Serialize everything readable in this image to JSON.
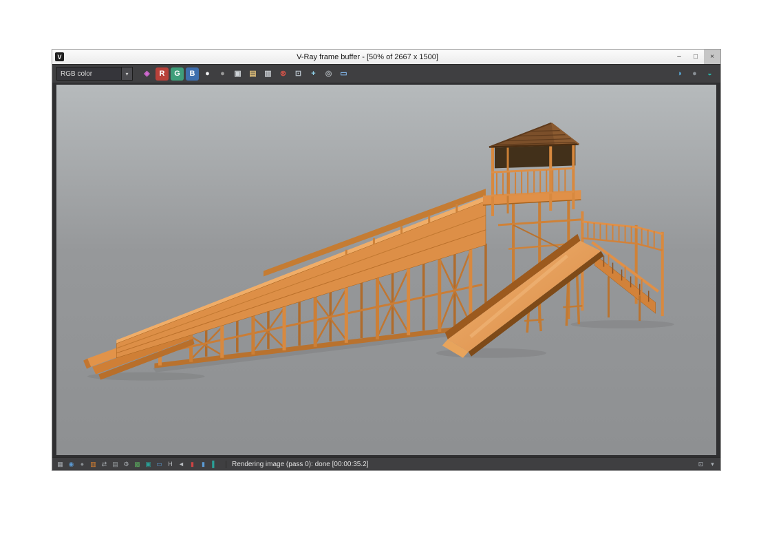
{
  "window": {
    "title": "V-Ray frame buffer - [50% of 2667 x 1500]",
    "app_icon_glyph": "V",
    "controls": [
      {
        "name": "minimize-button",
        "glyph": "–"
      },
      {
        "name": "maximize-button",
        "glyph": "□"
      },
      {
        "name": "close-button",
        "glyph": "×",
        "bg": "#c6c6c6"
      }
    ]
  },
  "toolbar": {
    "channel_dropdown": {
      "value": "RGB color",
      "arrow": "▾"
    },
    "left_buttons": [
      {
        "name": "vfb-channels-icon",
        "glyph": "◈",
        "color": "#d46ad4"
      },
      {
        "name": "red-channel-button",
        "glyph": "R",
        "color": "#ffffff",
        "bg": "#b8413a"
      },
      {
        "name": "green-channel-button",
        "glyph": "G",
        "color": "#ffffff",
        "bg": "#3f9e7a"
      },
      {
        "name": "blue-channel-button",
        "glyph": "B",
        "color": "#ffffff",
        "bg": "#3f6fae"
      },
      {
        "name": "alpha-channel-button",
        "glyph": "●",
        "color": "#f2f2f2"
      },
      {
        "name": "monochrome-button",
        "glyph": "●",
        "color": "#9a9a9a"
      },
      {
        "name": "save-image-button",
        "glyph": "▣",
        "color": "#cfd4d8"
      },
      {
        "name": "open-image-button",
        "glyph": "▤",
        "color": "#d8b977"
      },
      {
        "name": "clear-image-button",
        "glyph": "▥",
        "color": "#c7cbd0"
      },
      {
        "name": "stop-render-button",
        "glyph": "⊗",
        "color": "#d05248"
      },
      {
        "name": "duplicate-buffer-button",
        "glyph": "⊡",
        "color": "#b9c3cc"
      },
      {
        "name": "track-mouse-button",
        "glyph": "+",
        "color": "#8fd0e8"
      },
      {
        "name": "show-corrections-button",
        "glyph": "◎",
        "color": "#a8adb2"
      },
      {
        "name": "region-render-button",
        "glyph": "▭",
        "color": "#7fb2e5"
      }
    ],
    "right_buttons": [
      {
        "name": "color-corrections-button",
        "glyph": "◑",
        "color": "#5ab0e0"
      },
      {
        "name": "globals-button",
        "glyph": "●",
        "color": "#8a9096"
      },
      {
        "name": "lens-effects-button",
        "glyph": "◒",
        "color": "#2ab3a6"
      }
    ]
  },
  "statusbar": {
    "text": "Rendering image (pass 0): done [00:00:35.2]",
    "icons": [
      {
        "name": "sb-materials-icon",
        "glyph": "▦",
        "color": "#a8adb2"
      },
      {
        "name": "sb-world-icon",
        "glyph": "◉",
        "color": "#5b9bd5"
      },
      {
        "name": "sb-sphere-icon",
        "glyph": "●",
        "color": "#8a8f93"
      },
      {
        "name": "sb-palette-icon",
        "glyph": "▥",
        "color": "#e0842f"
      },
      {
        "name": "sb-swap-icon",
        "glyph": "⇄",
        "color": "#a8adb2"
      },
      {
        "name": "sb-layers-icon",
        "glyph": "▤",
        "color": "#9aa0a4"
      },
      {
        "name": "sb-settings-icon",
        "glyph": "⚙",
        "color": "#a8adb2"
      },
      {
        "name": "sb-grid-green-icon",
        "glyph": "▩",
        "color": "#58a55c"
      },
      {
        "name": "sb-teal-square-icon",
        "glyph": "▣",
        "color": "#2aa198"
      },
      {
        "name": "sb-blue-frame-icon",
        "glyph": "▭",
        "color": "#5b9bd5"
      },
      {
        "name": "sb-history-icon",
        "glyph": "H",
        "color": "#b8bcc0"
      },
      {
        "name": "sb-prev-icon",
        "glyph": "◄",
        "color": "#b8bcc0"
      },
      {
        "name": "sb-red-bar-icon",
        "glyph": "▮",
        "color": "#cc4444"
      },
      {
        "name": "sb-blue-bar-icon",
        "glyph": "▮",
        "color": "#5b9bd5"
      },
      {
        "name": "sb-teal-bar-icon",
        "glyph": "▌",
        "color": "#2aa198"
      }
    ],
    "right_icons": [
      {
        "name": "dock-buffer-icon",
        "glyph": "⊡",
        "color": "#aab0b6"
      },
      {
        "name": "collapse-bar-icon",
        "glyph": "▾",
        "color": "#aab0b6"
      }
    ]
  },
  "viewport": {
    "background_top": "#b6babc",
    "background_bottom": "#8e9092",
    "wood_color": "#dd8f47",
    "wood_dark": "#9c5a1e",
    "roof_color": "#7b4f2a"
  }
}
